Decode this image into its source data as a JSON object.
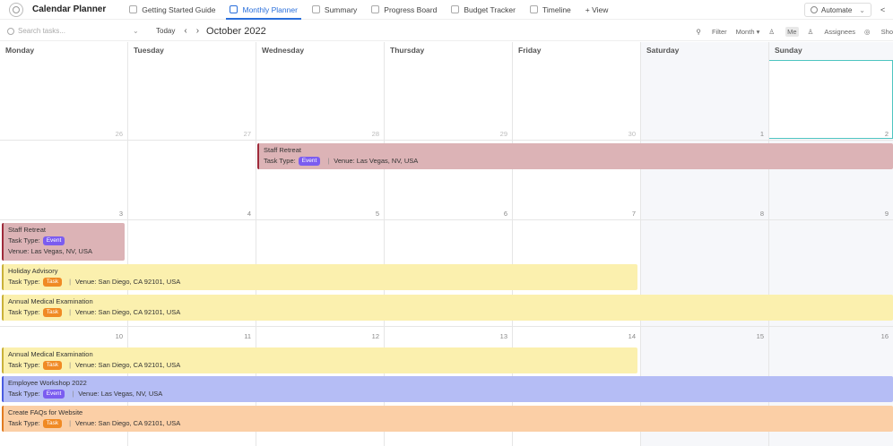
{
  "app": {
    "title": "Calendar Planner"
  },
  "tabs": [
    {
      "label": "Getting Started Guide",
      "icon": "doc-icon",
      "active": false
    },
    {
      "label": "Monthly Planner",
      "icon": "calendar-icon",
      "active": true
    },
    {
      "label": "Summary",
      "icon": "list-icon",
      "active": false
    },
    {
      "label": "Progress Board",
      "icon": "board-icon",
      "active": false
    },
    {
      "label": "Budget Tracker",
      "icon": "table-icon",
      "active": false
    },
    {
      "label": "Timeline",
      "icon": "timeline-icon",
      "active": false
    }
  ],
  "add_view_label": "+ View",
  "automate_label": "Automate",
  "toolbar": {
    "search_placeholder": "Search tasks...",
    "today_label": "Today",
    "prev_glyph": "‹",
    "next_glyph": "›",
    "month_label": "October 2022",
    "filter_label": "Filter",
    "month_select_label": "Month ▾",
    "me_label": "Me",
    "assignees_label": "Assignees",
    "show_label": "Sho"
  },
  "weekdays": [
    "Monday",
    "Tuesday",
    "Wednesday",
    "Thursday",
    "Friday",
    "Saturday",
    "Sunday"
  ],
  "weeks": [
    {
      "days": [
        "26",
        "27",
        "28",
        "29",
        "30",
        "1",
        "2"
      ]
    },
    {
      "days": [
        "3",
        "4",
        "5",
        "6",
        "7",
        "8",
        "9"
      ]
    },
    {
      "days": [
        "10",
        "11",
        "12",
        "13",
        "14",
        "15",
        "16"
      ]
    }
  ],
  "events": {
    "staff_retreat_1": {
      "title": "Staff Retreat",
      "type_label": "Task Type:",
      "badge": "Event",
      "venue": "Venue:  Las Vegas, NV, USA"
    },
    "staff_retreat_2": {
      "title": "Staff Retreat",
      "type_label": "Task Type:",
      "badge": "Event",
      "venue": "Venue:  Las Vegas, NV, USA"
    },
    "holiday_advisory": {
      "title": "Holiday Advisory",
      "type_label": "Task Type:",
      "badge": "Task",
      "venue": "Venue:  San Diego, CA 92101, USA"
    },
    "medical_1": {
      "title": "Annual Medical Examination",
      "type_label": "Task Type:",
      "badge": "Task",
      "venue": "Venue:  San Diego, CA 92101, USA"
    },
    "medical_2": {
      "title": "Annual Medical Examination",
      "type_label": "Task Type:",
      "badge": "Task",
      "venue": "Venue:  San Diego, CA 92101, USA"
    },
    "workshop": {
      "title": "Employee Workshop 2022",
      "type_label": "Task Type:",
      "badge": "Event",
      "venue": "Venue:  Las Vegas, NV, USA"
    },
    "faqs": {
      "title": "Create FAQs for Website",
      "type_label": "Task Type:",
      "badge": "Task",
      "venue": "Venue:  San Diego, CA 92101, USA"
    }
  },
  "colors": {
    "accent": "#2a6fdb",
    "event_badge": "#7b5cf0",
    "task_badge": "#f08a24",
    "retreat": "#dcb3b6",
    "advisory": "#fbf0ae",
    "workshop": "#b5bdf5",
    "faqs": "#fbcfa6",
    "today_outline": "#4ec5c1"
  }
}
